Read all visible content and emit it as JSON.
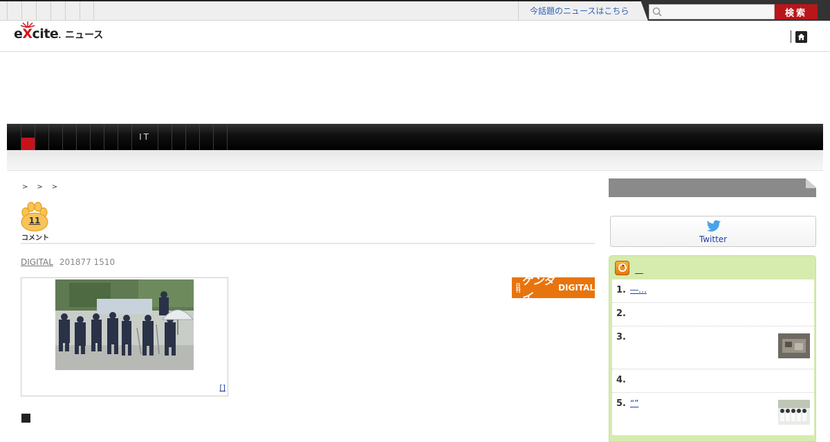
{
  "topbar": {
    "pill_count": 6,
    "trend_link": "今話題のニュースはこちら",
    "search_placeholder": "",
    "search_button": "検索"
  },
  "logo": {
    "brand_prefix": "e",
    "brand_x": "X",
    "brand_suffix": "cite",
    "brand_dot": ".",
    "product": "ニュース"
  },
  "category_nav": {
    "items": [
      "",
      "",
      "",
      "",
      "",
      "",
      "",
      "",
      "IT",
      "",
      "",
      "",
      "",
      "",
      ""
    ],
    "active_index": 0
  },
  "breadcrumb": [
    ">",
    ">",
    ">"
  ],
  "article": {
    "comment_count": "11",
    "comment_label": "コメント",
    "source": "DIGITAL",
    "date": "201877 1510",
    "photo_caption": "[]",
    "publisher_logo": {
      "small": "日刊",
      "big": "ゲンダイ",
      "digital": "DIGITAL"
    },
    "bullet": "■"
  },
  "sidebar": {
    "twitter_label": "Twitter",
    "ranking": {
      "title": "",
      "items": [
        {
          "rank": "1.",
          "text": "―…",
          "has_thumb": false
        },
        {
          "rank": "2.",
          "text": "",
          "has_thumb": false
        },
        {
          "rank": "3.",
          "text": "",
          "has_thumb": true
        },
        {
          "rank": "4.",
          "text": "",
          "has_thumb": false
        },
        {
          "rank": "5.",
          "text": "“”",
          "has_thumb": true
        }
      ]
    }
  },
  "colors": {
    "brand_red": "#d4141c",
    "nav_active": "#c4141a",
    "search_button": "#b8161b",
    "ranking_bg": "#d6ebae",
    "link": "#1a3fa8"
  },
  "icons": {
    "search": "search-icon",
    "home": "home-icon",
    "twitter": "twitter-icon",
    "paw": "paw-icon",
    "ranking": "ranking-icon"
  }
}
